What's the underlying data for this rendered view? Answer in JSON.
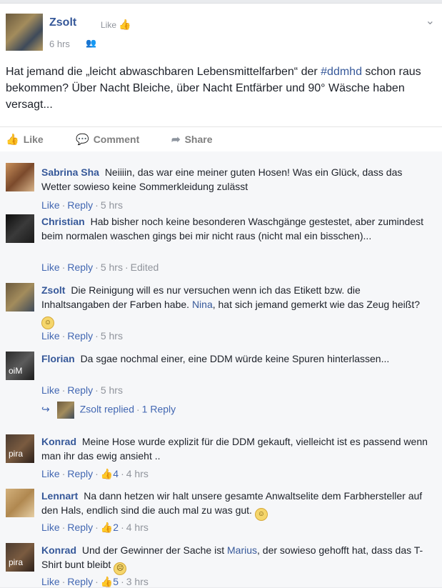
{
  "post": {
    "author": "Zsolt",
    "like_page": "Like",
    "time": "6 hrs",
    "text_pre": "Hat jemand die „leicht abwaschbaren Lebensmittelfarben“ der ",
    "hashtag": "#ddmhd",
    "text_post": " schon raus bekommen? Über Nacht Bleiche, über Nacht Entfärber und 90° Wäsche haben versagt...",
    "actions": {
      "like": "Like",
      "comment": "Comment",
      "share": "Share"
    }
  },
  "comments": [
    {
      "name": "Sabrina Sha",
      "text": "Neiiiin, das war eine meiner guten Hosen! Was ein Glück, dass das Wetter sowieso keine Sommerkleidung zulässt",
      "like": "Like",
      "reply": "Reply",
      "time": "5 hrs"
    },
    {
      "name": "Christian",
      "text": "Hab bisher noch keine besonderen Waschgänge gestestet, aber zumindest beim normalen waschen gings bei mir nicht raus (nicht mal ein bisschen)...",
      "like": "Like",
      "reply": "Reply",
      "time": "5 hrs",
      "edited": "Edited"
    },
    {
      "name": "Zsolt",
      "text_pre": "Die Reinigung will es nur versuchen wenn ich das Etikett bzw. die Inhaltsangaben der Farben habe. ",
      "mention": "Nina",
      "text_post": ", hat sich jemand gemerkt wie das Zeug heißt?",
      "like": "Like",
      "reply": "Reply",
      "time": "5 hrs"
    },
    {
      "name": "Florian",
      "avatar_label": "oiM",
      "text": "Da sgae nochmal einer, eine DDM würde keine Spuren hinterlassen...",
      "like": "Like",
      "reply": "Reply",
      "time": "5 hrs",
      "replies": {
        "name": "Zsolt",
        "replied": "replied",
        "count": "1 Reply"
      }
    },
    {
      "name": "Konrad",
      "avatar_label": "pira",
      "text": "Meine Hose wurde explizit für die DDM gekauft, vielleicht ist es passend wenn man ihr das ewig ansieht ..",
      "like": "Like",
      "reply": "Reply",
      "likes": "4",
      "time": "4 hrs"
    },
    {
      "name": "Lennart",
      "text": "Na dann hetzen wir halt unsere gesamte Anwaltselite dem Farbhersteller auf den Hals, endlich sind die auch mal zu was gut.",
      "like": "Like",
      "reply": "Reply",
      "likes": "2",
      "time": "4 hrs"
    },
    {
      "name": "Konrad",
      "avatar_label": "pira",
      "text_pre": "Und der Gewinner der Sache ist ",
      "mention": "Marius",
      "text_post": ", der sowieso gehofft hat, dass das T-Shirt bunt bleibt",
      "like": "Like",
      "reply": "Reply",
      "likes": "5",
      "time": "3 hrs"
    }
  ]
}
